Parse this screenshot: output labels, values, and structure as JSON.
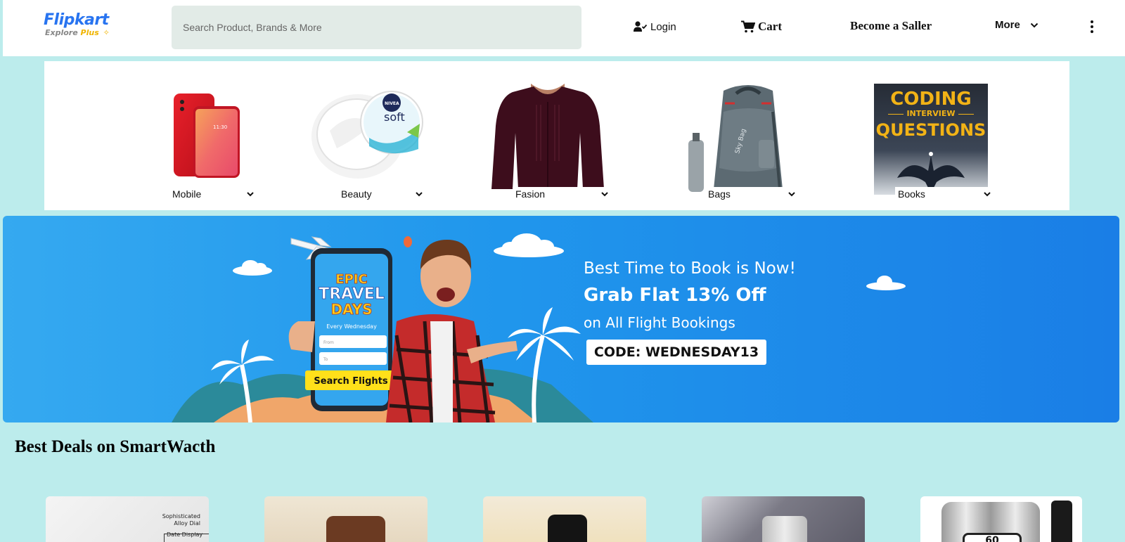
{
  "header": {
    "logo": {
      "main": "Flipkart",
      "sub_explore": "Explore",
      "sub_plus": "Plus"
    },
    "search": {
      "placeholder": "Search Product, Brands & More"
    },
    "login_label": "Login",
    "cart_label": "Cart",
    "seller_label": "Become a Saller",
    "more_label": "More"
  },
  "categories": [
    {
      "label": "Mobile"
    },
    {
      "label": "Beauty"
    },
    {
      "label": "Fasion"
    },
    {
      "label": "Bags"
    },
    {
      "label": "Books"
    }
  ],
  "book_cover": {
    "line1": "CODING",
    "line2": "INTERVIEW",
    "line3": "QUESTIONS"
  },
  "beauty_jar": {
    "brand": "NIVEA",
    "name": "soft"
  },
  "bag_brand": "Sky Bag",
  "banner": {
    "line1": "Best Time to Book is Now!",
    "line2": "Grab Flat 13% Off",
    "line3": "on All Flight Bookings",
    "code": "CODE: WEDNESDAY13",
    "phone_title1": "EPIC",
    "phone_title2": "TRAVEL",
    "phone_title3": "DAYS",
    "phone_sub": "Every Wednesday",
    "phone_from": "From",
    "phone_to": "To",
    "phone_button": "Search Flights"
  },
  "deals": {
    "title": "Best Deals on SmartWacth",
    "watch1_text1": "Sophisticated",
    "watch1_text2": "Alloy Dial",
    "watch1_text3": "Date Display",
    "watch5_text": "60"
  },
  "colors": {
    "page_bg": "#bcecec",
    "brand_blue": "#2874f0",
    "brand_yellow": "#f0b400",
    "banner_blue": "#2096ec"
  }
}
